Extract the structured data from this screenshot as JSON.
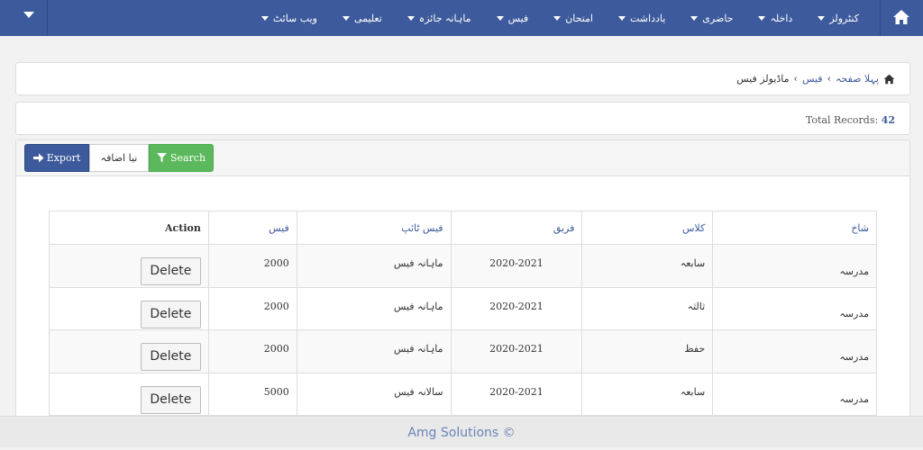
{
  "nav": {
    "items": [
      {
        "label": "کنٹرولز"
      },
      {
        "label": "داخلہ"
      },
      {
        "label": "حاضری"
      },
      {
        "label": "یادداشت"
      },
      {
        "label": "امتحان"
      },
      {
        "label": "فیس"
      },
      {
        "label": "ماہانہ جائزہ"
      },
      {
        "label": "تعلیمی"
      },
      {
        "label": "ویب سائٹ"
      }
    ],
    "home_icon": "home-icon",
    "dropdown_icon": "caret-down-icon",
    "brand_color": "#3d5a9c"
  },
  "breadcrumb": {
    "home": "پہلا صفحہ",
    "fees": "فیس",
    "current": "ماڈیولز فیس"
  },
  "records": {
    "label": "Total Records:",
    "count": "42"
  },
  "toolbar": {
    "export_label": "Export",
    "new_label": "نیا اضافہ",
    "search_label": "Search"
  },
  "table": {
    "headers": {
      "branch": "شاخ",
      "class": "کلاس",
      "session": "فریق",
      "fee_type": "فیس ٹائپ",
      "fee": "فیس",
      "action": "Action"
    },
    "rows": [
      {
        "branch": "مدرسہ",
        "class": "سابعہ",
        "session": "2020-2021",
        "fee_type": "ماہانہ فیس",
        "fee": "2000",
        "action": "Delete"
      },
      {
        "branch": "مدرسہ",
        "class": "ثالثہ",
        "session": "2020-2021",
        "fee_type": "ماہانہ فیس",
        "fee": "2000",
        "action": "Delete"
      },
      {
        "branch": "مدرسہ",
        "class": "حفظ",
        "session": "2020-2021",
        "fee_type": "ماہانہ فیس",
        "fee": "2000",
        "action": "Delete"
      },
      {
        "branch": "مدرسہ",
        "class": "سابعہ",
        "session": "2020-2021",
        "fee_type": "سالانہ فیس",
        "fee": "5000",
        "action": "Delete"
      }
    ]
  },
  "footer": {
    "text": "Amg Solutions ©"
  }
}
